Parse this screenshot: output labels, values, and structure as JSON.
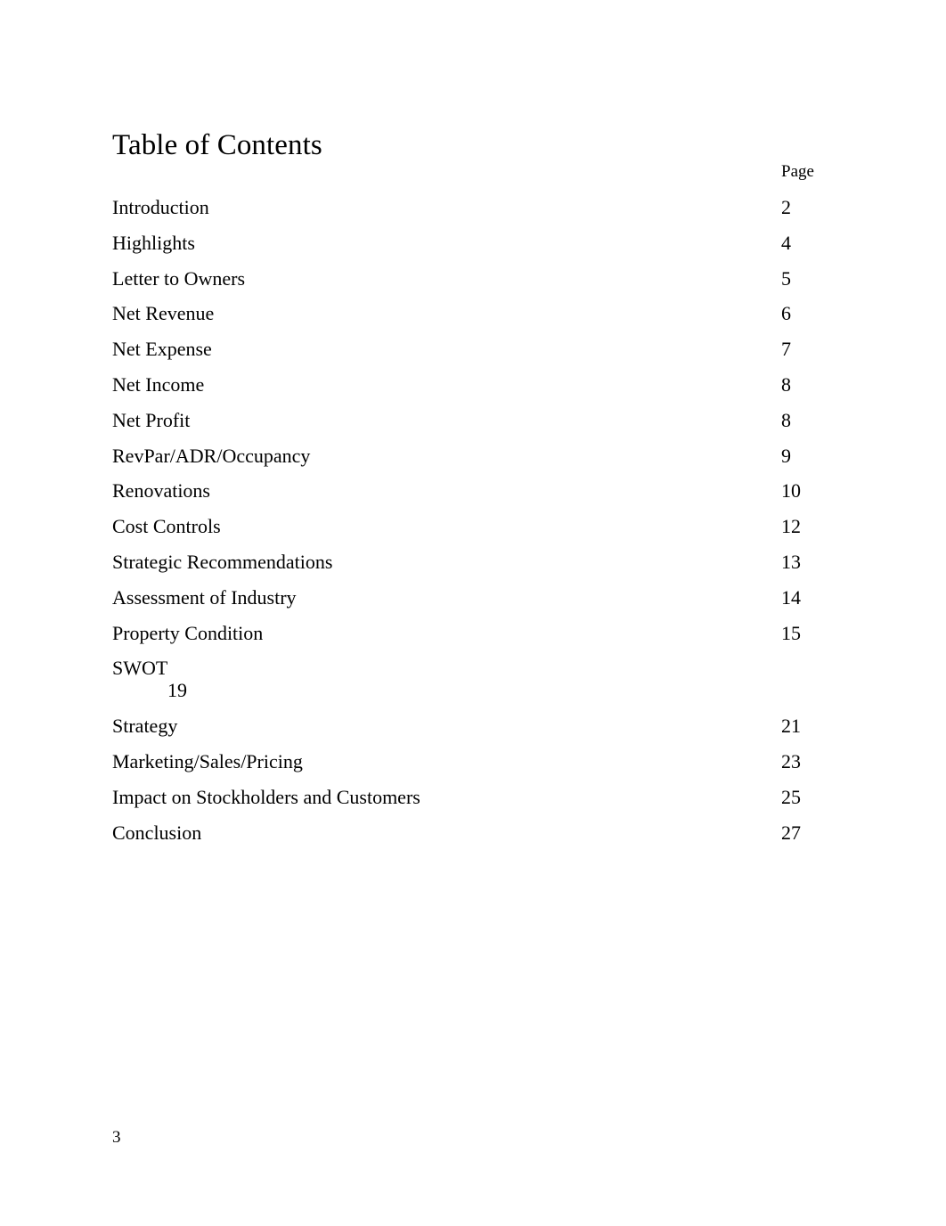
{
  "document": {
    "title": "Table of Contents",
    "page_column_header": "Page",
    "footer_page_number": "3"
  },
  "toc": {
    "entries": [
      {
        "label": "Introduction",
        "page": "2",
        "wrapped": false
      },
      {
        "label": "Highlights",
        "page": "4",
        "wrapped": false
      },
      {
        "label": "Letter to Owners",
        "page": "5",
        "wrapped": false
      },
      {
        "label": "Net Revenue",
        "page": "6",
        "wrapped": false
      },
      {
        "label": "Net Expense",
        "page": "7",
        "wrapped": false
      },
      {
        "label": "Net Income",
        "page": "8",
        "wrapped": false
      },
      {
        "label": "Net Profit",
        "page": "8",
        "wrapped": false
      },
      {
        "label": "RevPar/ADR/Occupancy",
        "page": "9",
        "wrapped": false
      },
      {
        "label": "Renovations",
        "page": "10",
        "wrapped": false
      },
      {
        "label": "Cost Controls",
        "page": "12",
        "wrapped": false
      },
      {
        "label": "Strategic Recommendations",
        "page": "13",
        "wrapped": false
      },
      {
        "label": "Assessment of Industry",
        "page": "14",
        "wrapped": false
      },
      {
        "label": "Property Condition",
        "page": "15",
        "wrapped": false
      },
      {
        "label": "SWOT",
        "page": "19",
        "wrapped": true
      },
      {
        "label": "Strategy",
        "page": "21",
        "wrapped": false
      },
      {
        "label": "Marketing/Sales/Pricing",
        "page": "23",
        "wrapped": false
      },
      {
        "label": "Impact on Stockholders and Customers",
        "page": "25",
        "wrapped": false
      },
      {
        "label": "Conclusion",
        "page": "27",
        "wrapped": false
      }
    ]
  }
}
